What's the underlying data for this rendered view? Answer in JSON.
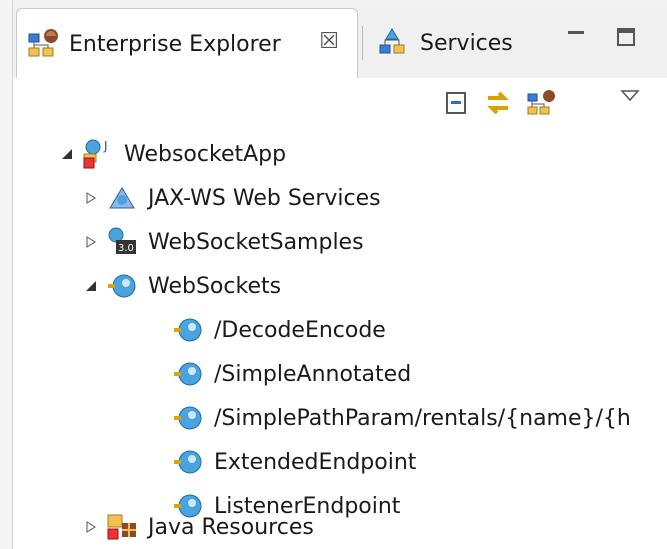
{
  "tabs": [
    {
      "label": "Enterprise Explorer",
      "icon": "enterprise-explorer-icon",
      "active": true,
      "close": "☒"
    },
    {
      "label": "Services",
      "icon": "services-icon",
      "active": false
    }
  ],
  "view_toolbar": [
    "collapse-all-icon",
    "link-with-editor-icon",
    "enterprise-explorer-icon"
  ],
  "tree": {
    "root": {
      "label": "WebsocketApp"
    },
    "children": [
      {
        "label": "JAX-WS Web Services"
      },
      {
        "label": "WebSocketSamples"
      },
      {
        "label": "WebSockets"
      },
      {
        "label": "/DecodeEncode"
      },
      {
        "label": "/SimpleAnnotated"
      },
      {
        "label": "/SimplePathParam/rentals/{name}/{h"
      },
      {
        "label": "ExtendedEndpoint"
      },
      {
        "label": "ListenerEndpoint"
      },
      {
        "label": "Java Resources"
      }
    ]
  }
}
